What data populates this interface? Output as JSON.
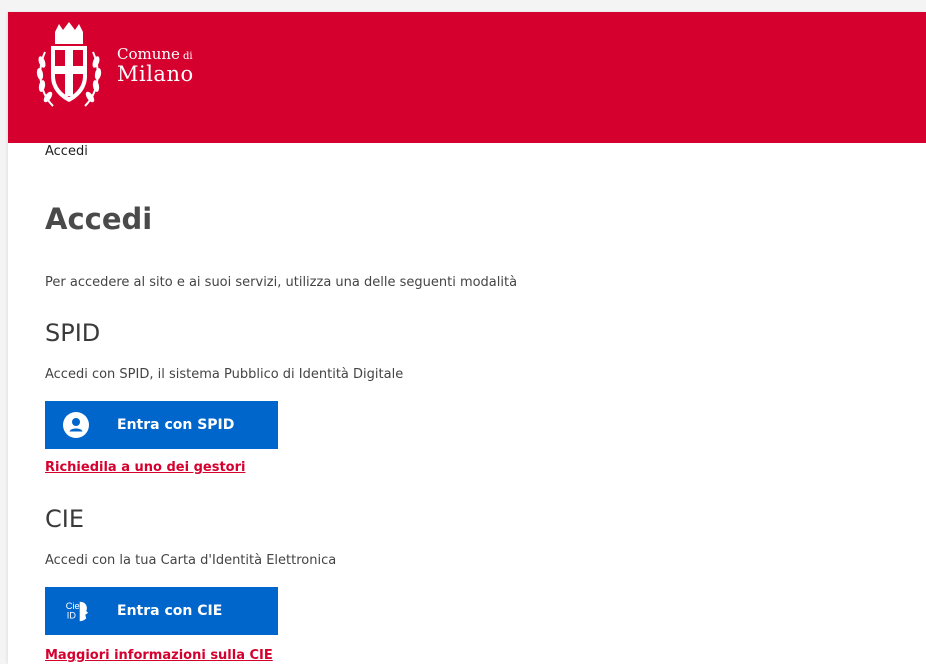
{
  "header": {
    "logo": {
      "line1": "Comune",
      "small": "di",
      "line2": "Milano"
    },
    "brand_color": "#d6002f"
  },
  "breadcrumb": {
    "current": "Accedi"
  },
  "page": {
    "title": "Accedi",
    "intro": "Per accedere al sito e ai suoi servizi, utilizza una delle seguenti modalità"
  },
  "spid": {
    "title": "SPID",
    "description": "Accedi con SPID, il sistema Pubblico di Identità Digitale",
    "button_label": "Entra con SPID",
    "button_icon": "spid-user-icon",
    "link_text": "Richiedila a uno dei gestori"
  },
  "cie": {
    "title": "CIE",
    "description": "Accedi con la tua Carta d'Identità Elettronica",
    "button_label": "Entra con CIE",
    "button_icon": "cie-id-icon",
    "link_text": "Maggiori informazioni sulla CIE"
  },
  "colors": {
    "button_blue": "#0066cc",
    "link_red": "#d6002f"
  }
}
